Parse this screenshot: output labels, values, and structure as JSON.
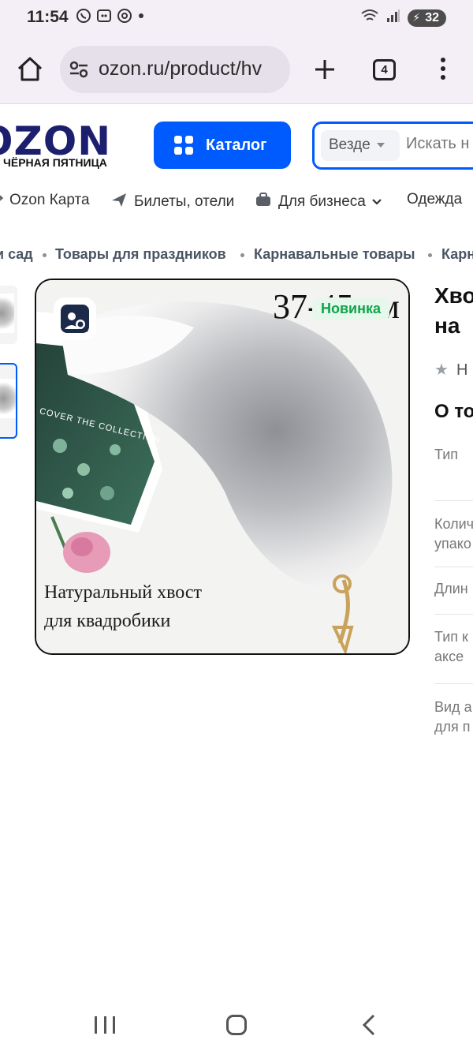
{
  "status_bar": {
    "time": "11:54",
    "left_icons": [
      "whatsapp-icon",
      "vpn-icon",
      "at-icon",
      "dot-icon"
    ],
    "battery": "32"
  },
  "browser": {
    "url": "ozon.ru/product/hv",
    "tab_count": "4"
  },
  "header": {
    "logo": "OZON",
    "logo_subtitle": "ЧЁРНАЯ ПЯТНИЦА",
    "catalog_label": "Каталог",
    "search_scope": "Везде",
    "search_placeholder": "Искать н"
  },
  "nav": {
    "items": [
      {
        "label": "Ozon Карта",
        "icon": "card-icon"
      },
      {
        "label": "Билеты, отели",
        "icon": "plane-icon"
      },
      {
        "label": "Для бизнеса",
        "icon": "briefcase-icon"
      },
      {
        "label": "Одежда",
        "icon": ""
      }
    ]
  },
  "breadcrumbs": [
    "и сад",
    "Товары для праздников",
    "Карнавальные товары",
    "Карн"
  ],
  "product": {
    "badge": "Новинка",
    "image_size_text": "37-45 см",
    "image_caption": "Натуральный хвост для квадробики",
    "image_collection_text": "COVER THE COLLECTION",
    "title_line1": "Хвос",
    "title_line2": "на",
    "rating_text": "Н",
    "about_heading": "О то",
    "specs": [
      {
        "label_line1": "Тип",
        "label_line2": ""
      },
      {
        "label_line1": "Колич",
        "label_line2": "упако"
      },
      {
        "label_line1": "Длин",
        "label_line2": ""
      },
      {
        "label_line1": "Тип к",
        "label_line2": "аксе"
      },
      {
        "label_line1": "Вид а",
        "label_line2": "для п"
      }
    ]
  },
  "colors": {
    "brand_blue": "#005bff",
    "logo_navy": "#1c1f6e",
    "badge_green": "#10a34a",
    "badge_bg": "#e6f7ec"
  }
}
